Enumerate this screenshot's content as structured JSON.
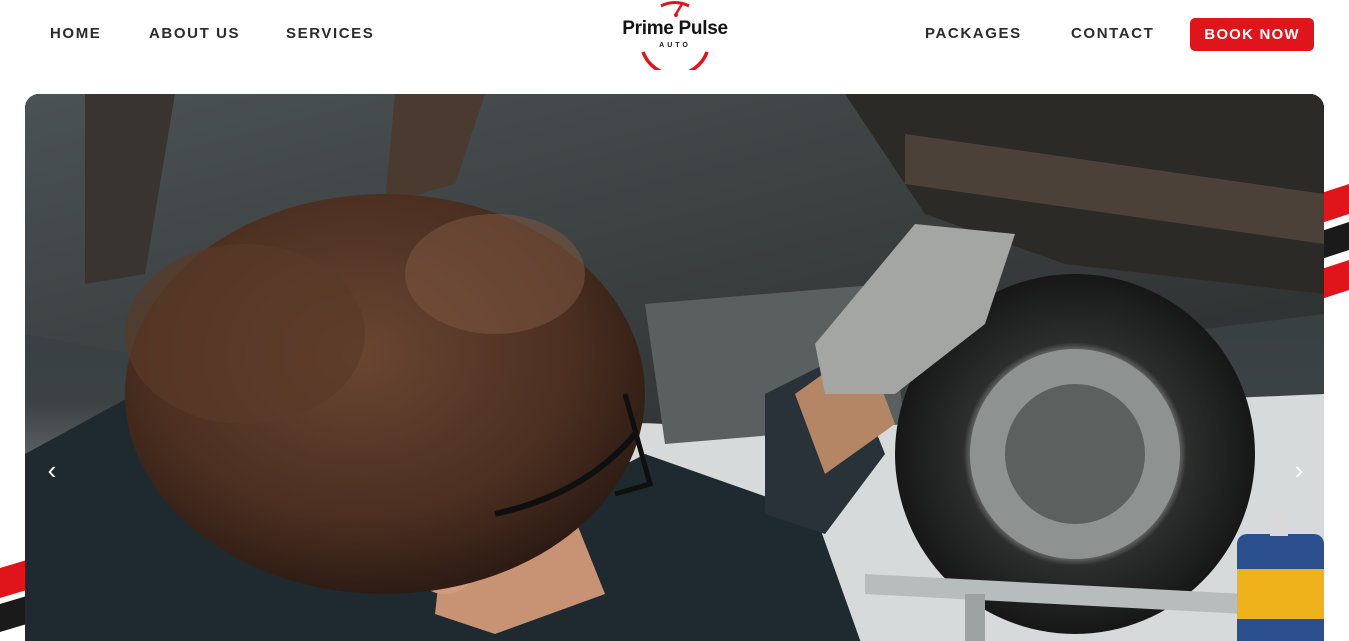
{
  "nav": {
    "left": [
      "HOME",
      "ABOUT US",
      "SERVICES"
    ],
    "right": [
      "PACKAGES",
      "CONTACT"
    ],
    "cta": "BOOK NOW"
  },
  "logo": {
    "title": "Prime Pulse",
    "subtitle": "AUTO"
  },
  "hero": {
    "image": "mechanic working under a lifted car",
    "prev_icon": "chevron-left-icon",
    "next_icon": "chevron-right-icon",
    "prev_glyph": "‹",
    "next_glyph": "›"
  },
  "colors": {
    "accent": "#e0151b",
    "nav_text": "#2b2b2b",
    "stripe_dark": "#1a1a1a"
  }
}
